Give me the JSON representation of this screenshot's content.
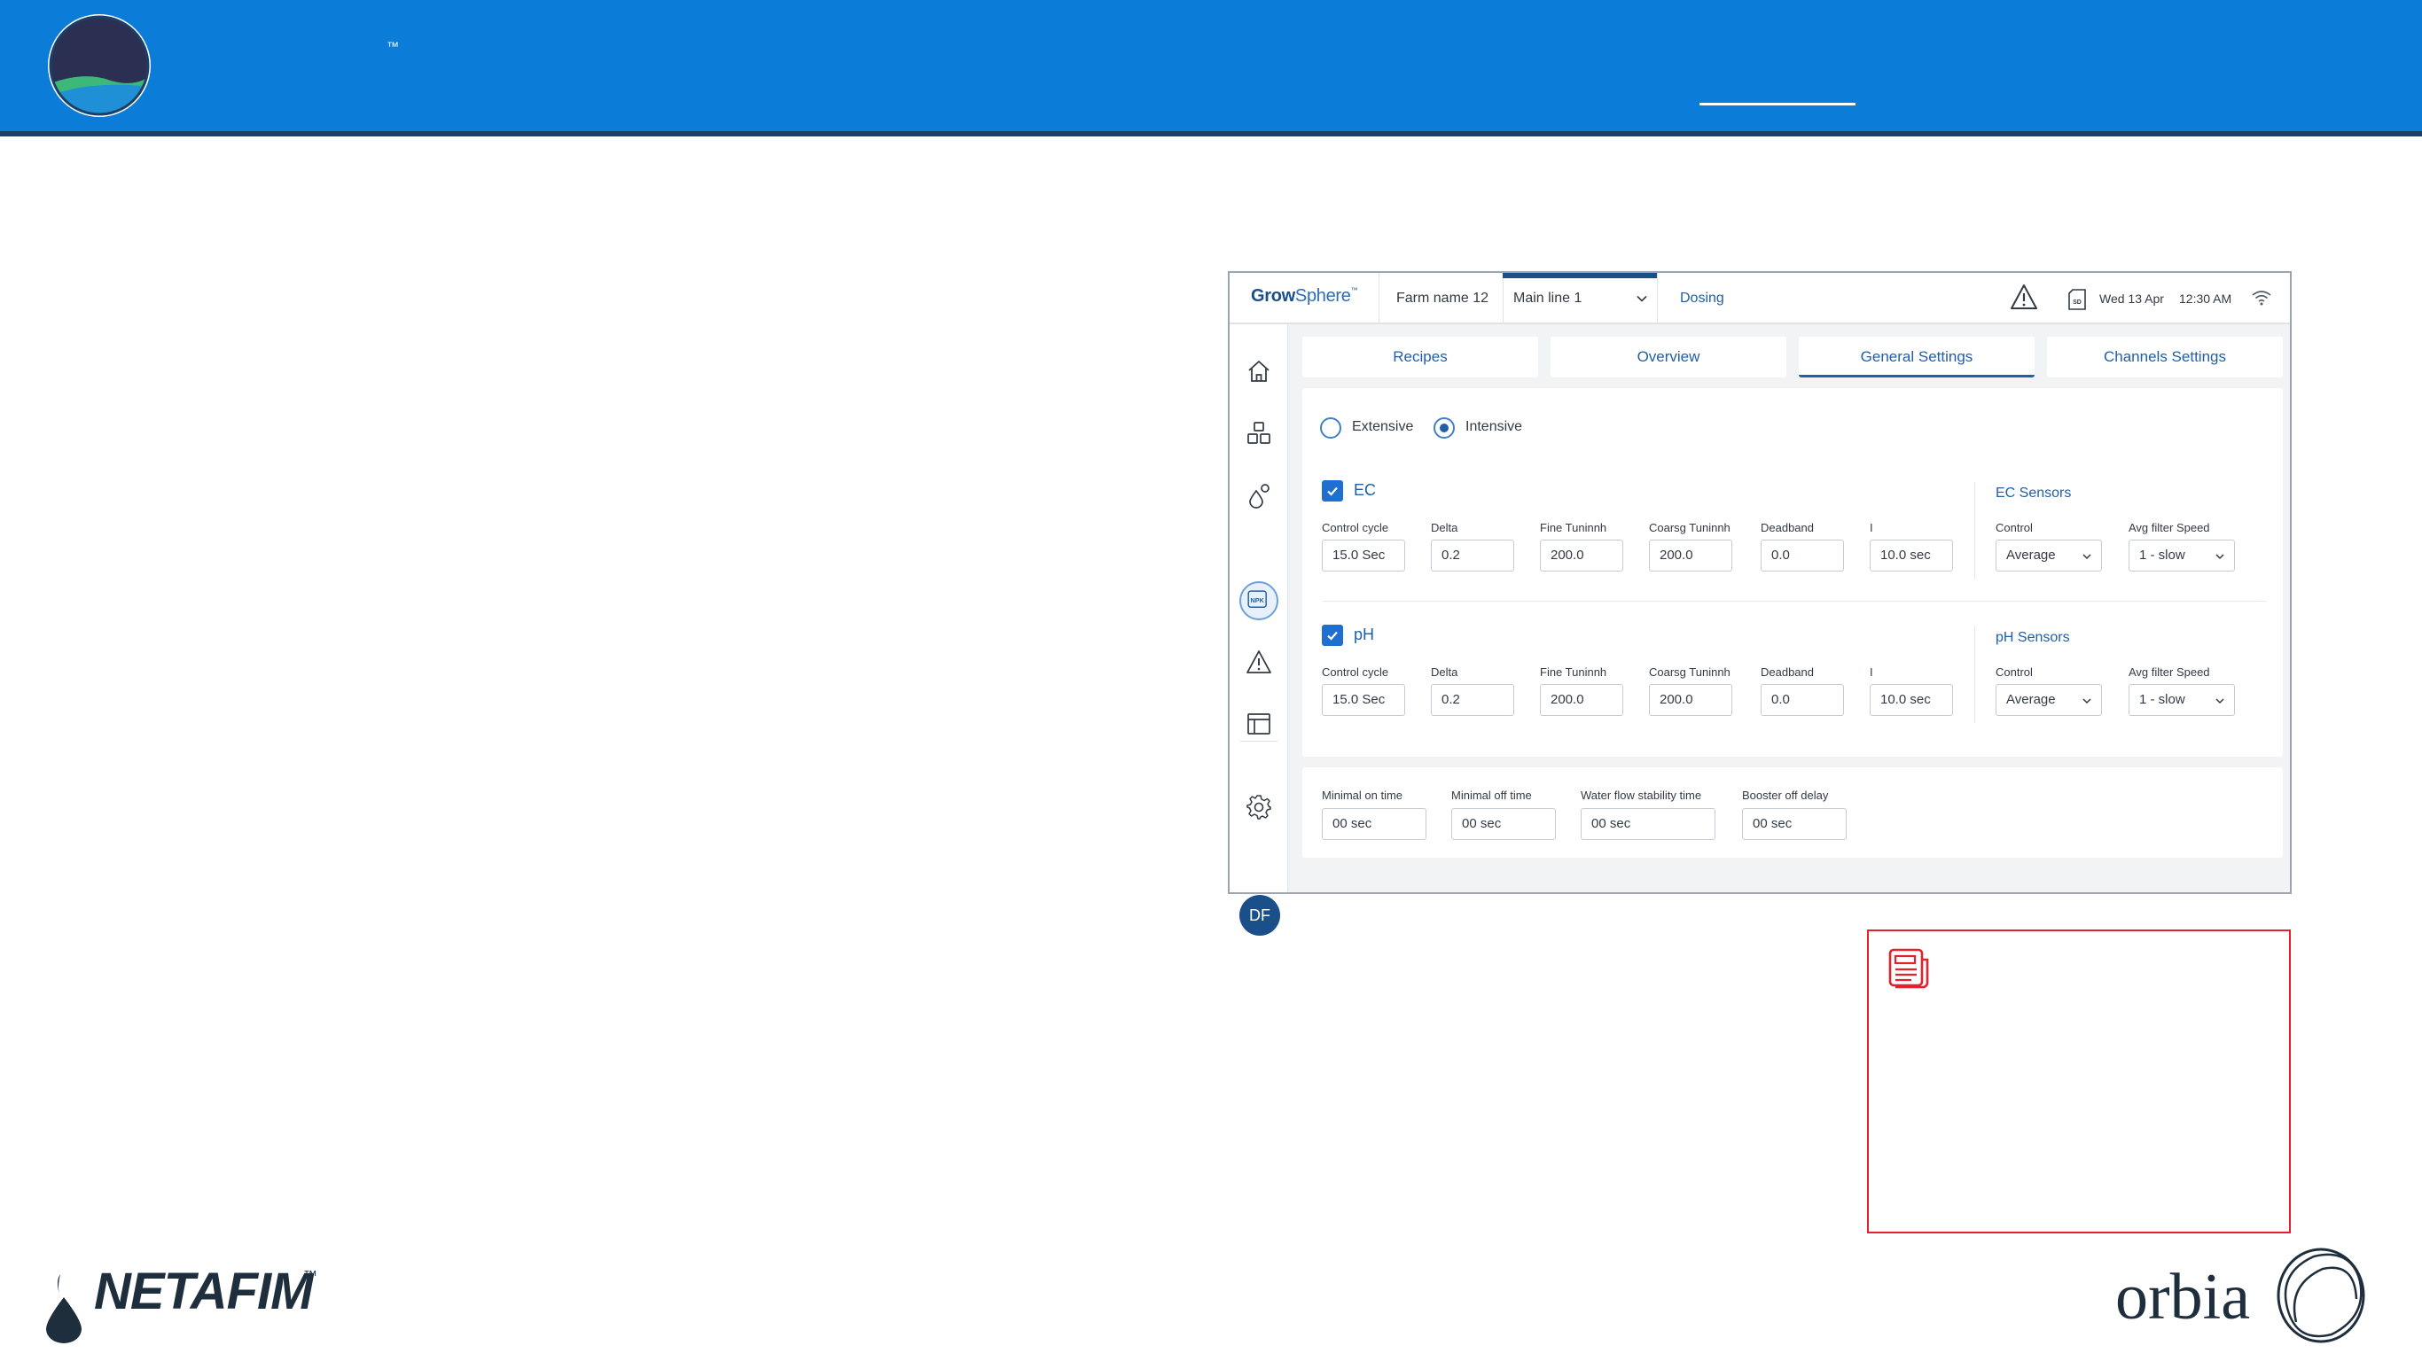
{
  "banner": {
    "trademark": "™"
  },
  "app": {
    "header": {
      "logo_bold": "Grow",
      "logo_light": "Sphere",
      "logo_tm": "™",
      "farm_name": "Farm name 12",
      "main_line": "Main line 1",
      "breadcrumb": "Dosing",
      "date": "Wed 13 Apr",
      "time": "12:30 AM",
      "sd_label": "SD"
    },
    "tabs": [
      {
        "label": "Recipes",
        "active": false
      },
      {
        "label": "Overview",
        "active": false
      },
      {
        "label": "General Settings",
        "active": true
      },
      {
        "label": "Channels Settings",
        "active": false
      }
    ],
    "mode": {
      "options": [
        "Extensive",
        "Intensive"
      ],
      "selected": "Intensive"
    },
    "ec": {
      "title": "EC",
      "checked": true,
      "fields": [
        {
          "label": "Control cycle",
          "value": "15.0 Sec"
        },
        {
          "label": "Delta",
          "value": "0.2"
        },
        {
          "label": "Fine Tuninnh",
          "value": "200.0"
        },
        {
          "label": "Coarsg Tuninnh",
          "value": "200.0"
        },
        {
          "label": "Deadband",
          "value": "0.0"
        },
        {
          "label": "I",
          "value": "10.0 sec"
        }
      ],
      "sensors": {
        "title": "EC Sensors",
        "control_label": "Control",
        "control_value": "Average",
        "filter_label": "Avg filter Speed",
        "filter_value": "1 - slow"
      }
    },
    "ph": {
      "title": "pH",
      "checked": true,
      "fields": [
        {
          "label": "Control cycle",
          "value": "15.0 Sec"
        },
        {
          "label": "Delta",
          "value": "0.2"
        },
        {
          "label": "Fine Tuninnh",
          "value": "200.0"
        },
        {
          "label": "Coarsg Tuninnh",
          "value": "200.0"
        },
        {
          "label": "Deadband",
          "value": "0.0"
        },
        {
          "label": "I",
          "value": "10.0 sec"
        }
      ],
      "sensors": {
        "title": "pH Sensors",
        "control_label": "Control",
        "control_value": "Average",
        "filter_label": "Avg filter Speed",
        "filter_value": "1 - slow"
      }
    },
    "timing": [
      {
        "label": "Minimal on time",
        "value": "00 sec"
      },
      {
        "label": "Minimal off time",
        "value": "00 sec"
      },
      {
        "label": "Water flow stability time",
        "value": "00 sec"
      },
      {
        "label": "Booster off delay",
        "value": "00 sec"
      }
    ],
    "sidebar": {
      "icons": [
        "home-icon",
        "fertigation-icon",
        "dosing-icon",
        "npk-icon",
        "alarm-icon",
        "table-icon",
        "settings-icon"
      ],
      "npk_label": "NPK",
      "avatar_initials": "DF"
    }
  },
  "footer": {
    "netafim": "NETAFIM",
    "netafim_tm": "™",
    "orbia": "orbia"
  },
  "colors": {
    "banner": "#0b7dd8",
    "banner_rule": "#1b3f66",
    "accent": "#1f5fa8",
    "note_border": "#e3222b"
  }
}
